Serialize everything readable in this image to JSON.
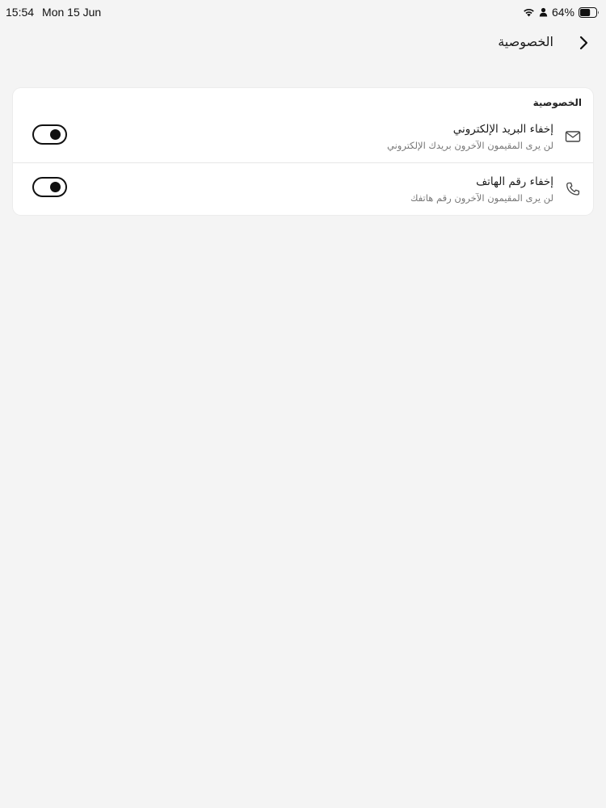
{
  "status_bar": {
    "time": "15:54",
    "date": "Mon 15 Jun",
    "battery_percent": "64%",
    "battery_level": 0.64,
    "icons": [
      "wifi-icon",
      "person-icon",
      "battery-icon"
    ]
  },
  "header": {
    "title": "الخصوصية",
    "back_icon": "chevron-right-icon"
  },
  "privacy": {
    "section_title": "الخصوصية",
    "items": [
      {
        "icon": "mail-icon",
        "label": "إخفاء البريد الإلكتروني",
        "description": "لن يرى المقيمون الآخرون بريدك الإلكتروني",
        "enabled": true
      },
      {
        "icon": "phone-icon",
        "label": "إخفاء رقم الهاتف",
        "description": "لن يرى المقيمون الآخرون رقم هاتفك",
        "enabled": true
      }
    ]
  },
  "colors": {
    "background": "#f4f4f4",
    "card": "#ffffff",
    "text": "#1a1a1a",
    "secondary_text": "#777777",
    "toggle": "#111111"
  }
}
